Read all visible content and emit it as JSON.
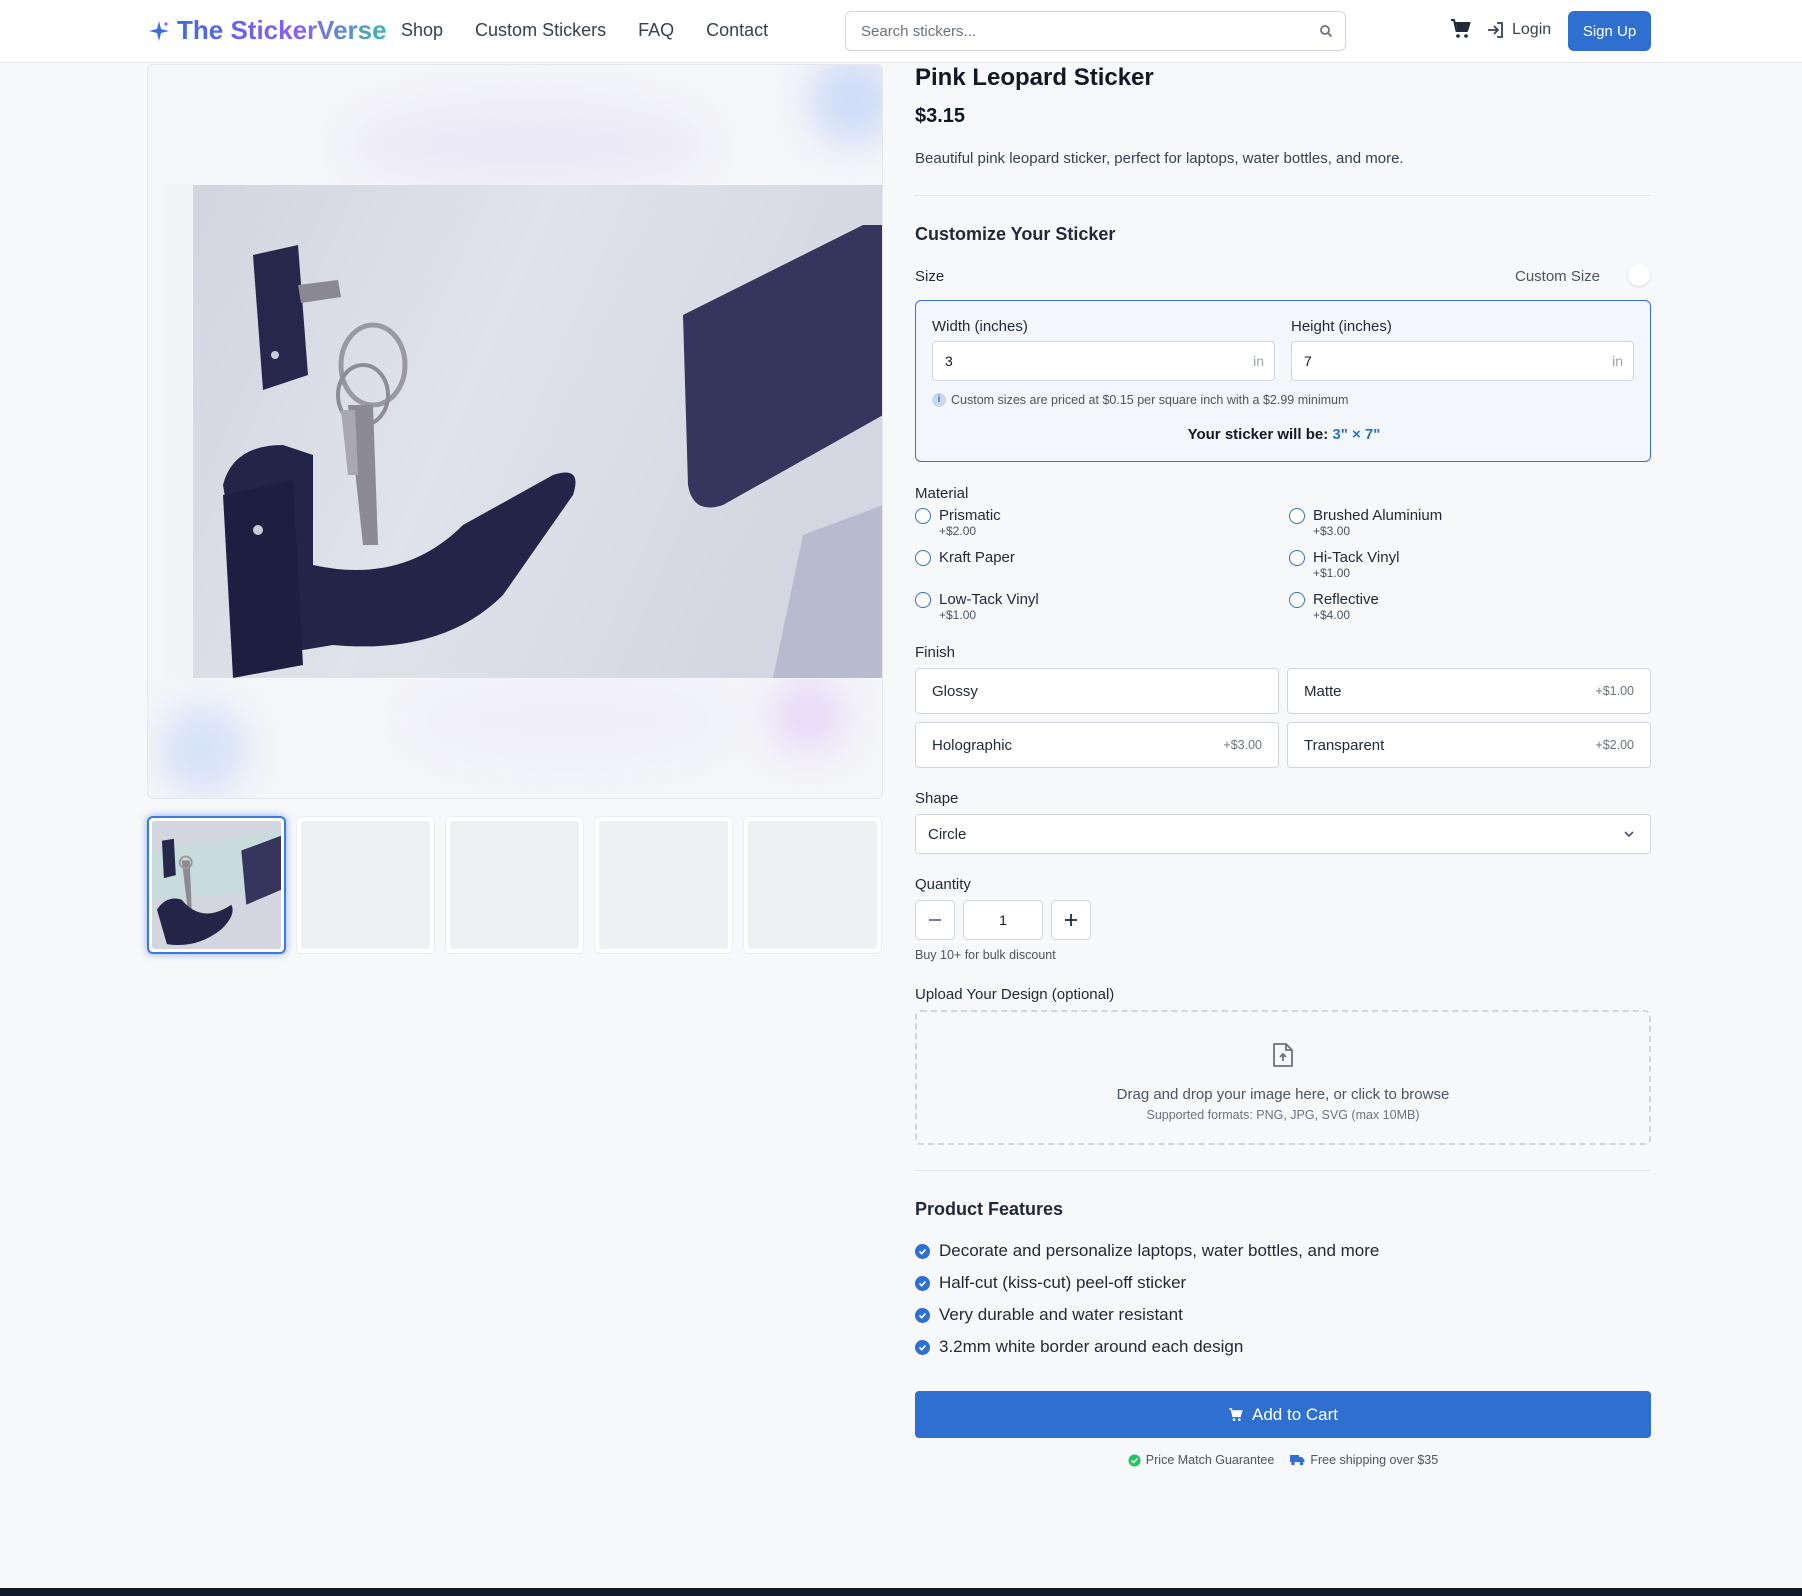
{
  "header": {
    "logo": "The StickerVerse",
    "nav": [
      "Shop",
      "Custom Stickers",
      "FAQ",
      "Contact"
    ],
    "search_placeholder": "Search stickers...",
    "login_label": "Login",
    "signup_label": "Sign Up"
  },
  "gallery": {
    "thumbnail_count": 5,
    "active_index": 0
  },
  "product": {
    "title": "Pink Leopard Sticker",
    "price": "$3.15",
    "description": "Beautiful pink leopard sticker, perfect for laptops, water bottles, and more."
  },
  "customize": {
    "heading": "Customize Your Sticker",
    "size_label": "Size",
    "custom_size_label": "Custom Size",
    "width_label": "Width (inches)",
    "width_value": "3",
    "height_label": "Height (inches)",
    "height_value": "7",
    "unit": "in",
    "pricing_note": "Custom sizes are priced at $0.15 per square inch with a $2.99 minimum",
    "result_prefix": "Your sticker will be:",
    "result_value": "3\" × 7\"",
    "material_label": "Material",
    "materials": [
      {
        "name": "Prismatic",
        "price": "+$2.00"
      },
      {
        "name": "Brushed Aluminium",
        "price": "+$3.00"
      },
      {
        "name": "Kraft Paper",
        "price": ""
      },
      {
        "name": "Hi-Tack Vinyl",
        "price": "+$1.00"
      },
      {
        "name": "Low-Tack Vinyl",
        "price": "+$1.00"
      },
      {
        "name": "Reflective",
        "price": "+$4.00"
      }
    ],
    "finish_label": "Finish",
    "finishes": [
      {
        "name": "Glossy",
        "price": ""
      },
      {
        "name": "Matte",
        "price": "+$1.00"
      },
      {
        "name": "Holographic",
        "price": "+$3.00"
      },
      {
        "name": "Transparent",
        "price": "+$2.00"
      }
    ],
    "shape_label": "Shape",
    "shape_value": "Circle",
    "quantity_label": "Quantity",
    "quantity_value": "1",
    "bulk_note": "Buy 10+ for bulk discount",
    "upload_label": "Upload Your Design (optional)",
    "upload_text": "Drag and drop your image here, or click to browse",
    "upload_formats": "Supported formats: PNG, JPG, SVG (max 10MB)"
  },
  "features": {
    "heading": "Product Features",
    "items": [
      "Decorate and personalize laptops, water bottles, and more",
      "Half-cut (kiss-cut) peel-off sticker",
      "Very durable and water resistant",
      "3.2mm white border around each design"
    ]
  },
  "cart": {
    "add_label": "Add to Cart",
    "badge_price_match": "Price Match Guarantee",
    "badge_shipping": "Free shipping over $35"
  },
  "colors": {
    "primary": "#2f6fd0",
    "background": "#f7f8fa",
    "success": "#22c55e"
  }
}
